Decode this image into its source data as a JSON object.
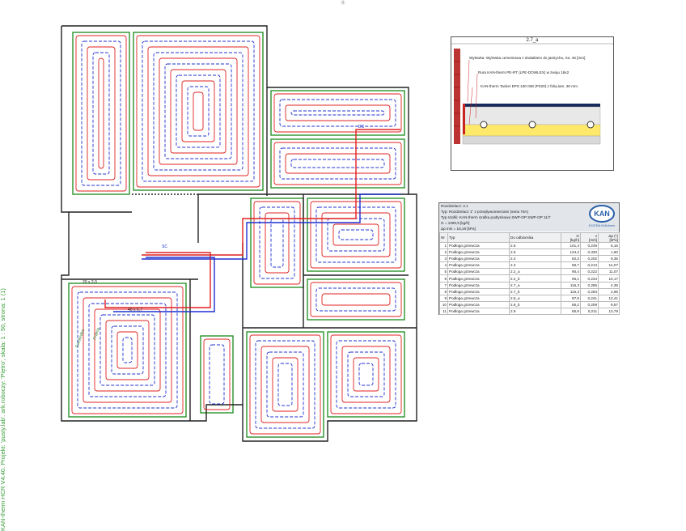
{
  "page_marker": "Ⓐ",
  "side_caption": "KAN-therm HCR V4.40. Projekt: 'pusty.lab'. ark.roboczy: 'Piętro', skala: 1 : 50, strona: 1 (1)",
  "section": {
    "title": "2.7_a",
    "layers": [
      "Wylewka: Wylewka cementowa z dodatkiem do jastrychu, Su: 45 [mm]",
      "Rura KAN-therm PE-RT (LPE-DOWLEX) w zwoju 16x2",
      "KAN-therm Tacker EPS 100 038 (PS20) z folią lam. 30 mm"
    ]
  },
  "manifold_table": {
    "header_lines": [
      "Rozdzielacz: 2.1",
      "Typ: Rozdzielacz 1\" z przepływomierzami (seria 75A)",
      "Typ szafki: KAN-therm szafka podtynkowa SWP-OP SWP-OP 11/7",
      "G = 1090,9 [kg/h]",
      "Δp min = 18,19 [kPa]"
    ],
    "columns": [
      "Nr",
      "Typ",
      "Do odbiornika",
      "G\n[kg/h]",
      "v\n[m/s]",
      "Δp (*)\n[kPa]"
    ],
    "rows": [
      [
        "1",
        "Podłoga grzewcza",
        "2.6",
        "101,4",
        "0,249",
        "6,16"
      ],
      [
        "2",
        "Podłoga grzewcza",
        "2.5",
        "134,2",
        "0,330",
        "1,50"
      ],
      [
        "3",
        "Podłoga grzewcza",
        "2.4",
        "82,3",
        "0,202",
        "9,35"
      ],
      [
        "4",
        "Podłoga grzewcza",
        "2.3",
        "86,7",
        "0,213",
        "14,07"
      ],
      [
        "5",
        "Podłoga grzewcza",
        "2.2_a",
        "90,4",
        "0,222",
        "11,07"
      ],
      [
        "6",
        "Podłoga grzewcza",
        "2.2_b",
        "95,1",
        "0,234",
        "10,17"
      ],
      [
        "7",
        "Podłoga grzewcza",
        "2.7_a",
        "116,3",
        "0,286",
        "4,36"
      ],
      [
        "8",
        "Podłoga grzewcza",
        "2.7_b",
        "115,3",
        "0,283",
        "4,96"
      ],
      [
        "9",
        "Podłoga grzewcza",
        "2.8_a",
        "97,9",
        "0,241",
        "12,41"
      ],
      [
        "10",
        "Podłoga grzewcza",
        "2.8_b",
        "85,2",
        "0,209",
        "9,57"
      ],
      [
        "11",
        "Podłoga grzewcza",
        "2.9",
        "85,9",
        "0,211",
        "13,79"
      ]
    ]
  },
  "logo": {
    "text": "KAN",
    "subtext": "SYSTEM KAN-therm"
  },
  "plan_labels": {
    "zone_a": "20 x 2,0",
    "zone_b": "40 x 6,7",
    "room_1": "Garderoba",
    "room_2": "Pralnia",
    "dc": "DC",
    "sc": "SC"
  },
  "colors": {
    "supply": "#e02020",
    "return": "#2030d0",
    "wall": "#222222",
    "zone_border": "#1a8a1a",
    "caption": "#3a9c3a"
  }
}
